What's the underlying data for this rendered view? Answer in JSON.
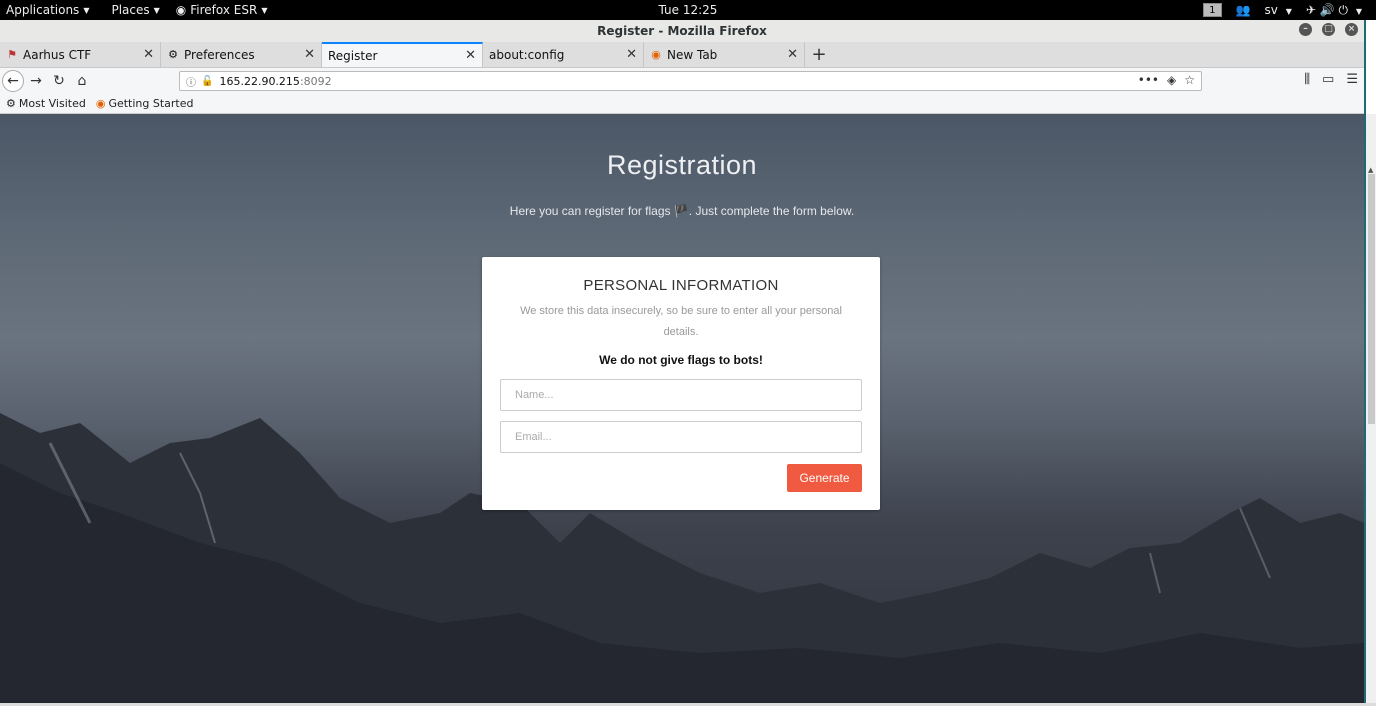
{
  "topbar": {
    "applications": "Applications",
    "places": "Places",
    "firefox_menu": "Firefox ESR",
    "clock": "Tue 12:25",
    "workspace": "1",
    "keyboard_layout": "sv"
  },
  "window": {
    "title": "Register - Mozilla Firefox"
  },
  "tabs": [
    {
      "label": "Aarhus CTF",
      "icon": "ctf-favicon"
    },
    {
      "label": "Preferences",
      "icon": "gear-icon"
    },
    {
      "label": "Register",
      "icon": ""
    },
    {
      "label": "about:config",
      "icon": ""
    },
    {
      "label": "New Tab",
      "icon": "firefox-icon"
    }
  ],
  "urlbar": {
    "host": "165.22.90.215",
    "port": ":8092"
  },
  "bookmarks": [
    {
      "label": "Most Visited",
      "icon": "gear-icon"
    },
    {
      "label": "Getting Started",
      "icon": "firefox-icon"
    }
  ],
  "page": {
    "title": "Registration",
    "subtitle": "Here you can register for flags 🏴. Just complete the form below.",
    "card": {
      "title": "PERSONAL INFORMATION",
      "description": "We store this data insecurely, so be sure to enter all your personal details.",
      "warning": "We do not give flags to bots!",
      "name_placeholder": "Name...",
      "email_placeholder": "Email...",
      "button": "Generate"
    }
  },
  "colors": {
    "accent_button": "#ef5a40",
    "active_tab_border": "#0a84ff"
  }
}
